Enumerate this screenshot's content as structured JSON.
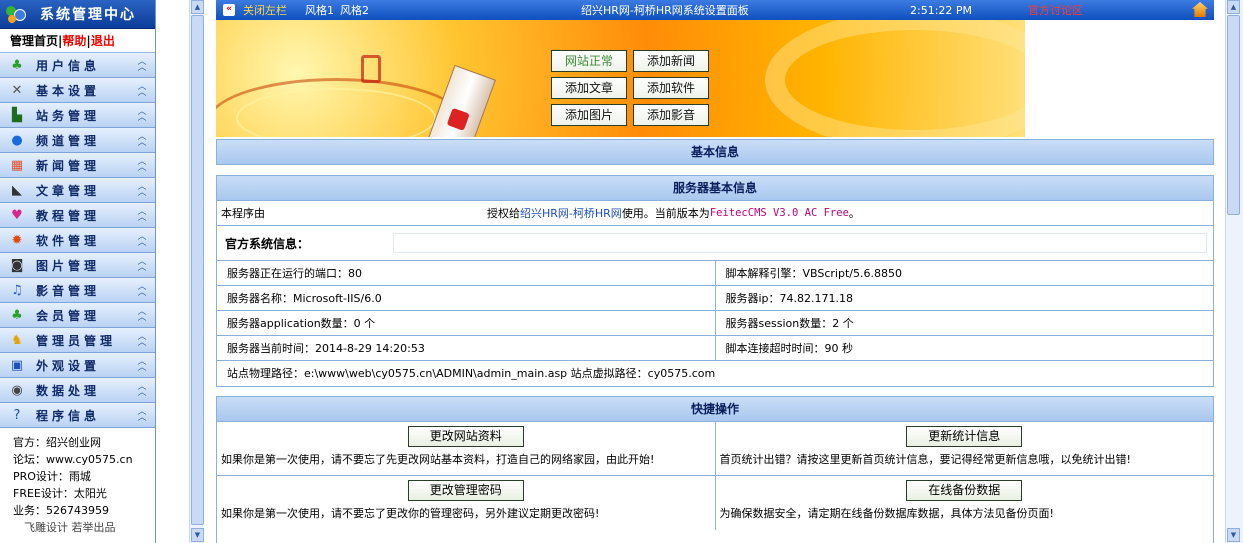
{
  "sidebar": {
    "title": "系统管理中心",
    "links": {
      "home": "管理首页",
      "sep1": "|",
      "help": "帮助",
      "sep2": "|",
      "logout": "退出"
    },
    "items": [
      {
        "label": "用户信息",
        "icon": "users-icon"
      },
      {
        "label": "基本设置",
        "icon": "tools-icon"
      },
      {
        "label": "站务管理",
        "icon": "monitor-icon"
      },
      {
        "label": "频道管理",
        "icon": "globe-icon"
      },
      {
        "label": "新闻管理",
        "icon": "windows-icon"
      },
      {
        "label": "文章管理",
        "icon": "lamp-icon"
      },
      {
        "label": "教程管理",
        "icon": "heart-icon"
      },
      {
        "label": "软件管理",
        "icon": "gear-ball-icon"
      },
      {
        "label": "图片管理",
        "icon": "camera-icon"
      },
      {
        "label": "影音管理",
        "icon": "music-icon"
      },
      {
        "label": "会员管理",
        "icon": "members-icon"
      },
      {
        "label": "管理员管理",
        "icon": "admin-icon"
      },
      {
        "label": "外观设置",
        "icon": "display-icon"
      },
      {
        "label": "数据处理",
        "icon": "disk-icon"
      },
      {
        "label": "程序信息",
        "icon": "help-icon"
      }
    ],
    "info": [
      "官方：绍兴创业网",
      "论坛：www.cy0575.cn",
      "PRO设计：雨城",
      "FREE设计：太阳光",
      "业务：526743959",
      "　飞雕设计  若举出品"
    ]
  },
  "topbar": {
    "close_left": "关闭左栏",
    "style1": "风格1",
    "style2": "风格2",
    "title": "绍兴HR网-柯桥HR网系统设置面板",
    "time": "2:51:22 PM",
    "forum": "官方讨论区"
  },
  "banner_buttons": [
    "网站正常",
    "添加新闻",
    "添加文章",
    "添加软件",
    "添加图片",
    "添加影音"
  ],
  "basic_info": {
    "header": "基本信息"
  },
  "server": {
    "header": "服务器基本信息",
    "program_label": "本程序由",
    "license_prefix": "授权给",
    "license_site": "绍兴HR网-柯桥HR网",
    "license_mid": "使用。当前版本为",
    "version": "FeitecCMS V3.0 AC Free",
    "license_end": "。",
    "official_label": "官方系统信息：",
    "rows": [
      [
        "服务器正在运行的端口：80",
        "脚本解释引擎：VBScript/5.6.8850"
      ],
      [
        "服务器名称：Microsoft-IIS/6.0",
        "服务器ip：74.82.171.18"
      ],
      [
        "服务器application数量：0 个",
        "服务器session数量：2 个"
      ],
      [
        "服务器当前时间：2014-8-29 14:20:53",
        "脚本连接超时时间：90 秒"
      ]
    ],
    "path": "站点物理路径：e:\\www\\web\\cy0575.cn\\ADMIN\\admin_main.asp  站点虚拟路径：cy0575.com"
  },
  "quick": {
    "header": "快捷操作",
    "cells": [
      {
        "button": "更改网站资料",
        "desc": "如果你是第一次使用，请不要忘了先更改网站基本资料，打造自己的网络家园，由此开始!"
      },
      {
        "button": "更新统计信息",
        "desc": "首页统计出错？请按这里更新首页统计信息，要记得经常更新信息哦，以免统计出错!"
      },
      {
        "button": "更改管理密码",
        "desc": "如果你是第一次使用，请不要忘了更改你的管理密码，另外建议定期更改密码!"
      },
      {
        "button": "在线备份数据",
        "desc": "为确保数据安全，请定期在线备份数据库数据，具体方法见备份页面!"
      }
    ]
  },
  "colors": {
    "accent": "#0f4fbf",
    "panel_header": "#a9c8ef",
    "alert": "#ff3b2f"
  }
}
